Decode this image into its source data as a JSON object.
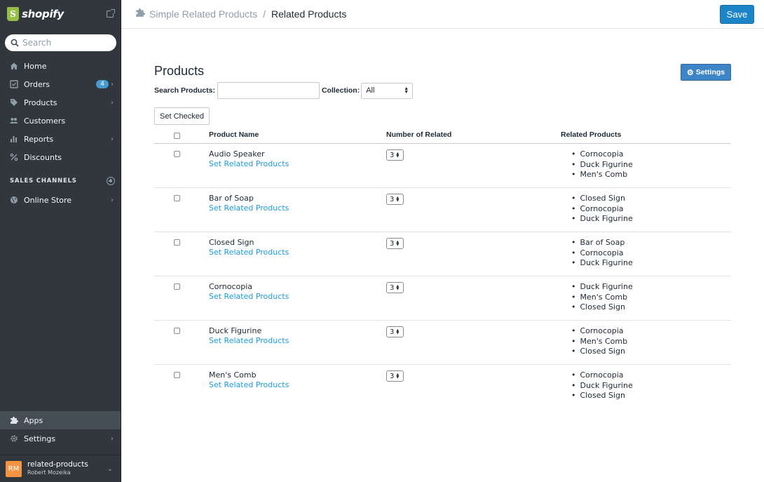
{
  "sidebar": {
    "brand": "shopify",
    "search_placeholder": "Search",
    "nav": [
      {
        "label": "Home",
        "icon": "home-icon"
      },
      {
        "label": "Orders",
        "icon": "orders-icon",
        "badge": "4"
      },
      {
        "label": "Products",
        "icon": "tag-icon"
      },
      {
        "label": "Customers",
        "icon": "customers-icon"
      },
      {
        "label": "Reports",
        "icon": "bar-chart-icon"
      },
      {
        "label": "Discounts",
        "icon": "discount-icon"
      }
    ],
    "sales_channels_heading": "SALES CHANNELS",
    "channels": [
      {
        "label": "Online Store",
        "icon": "globe-icon"
      }
    ],
    "bottom_nav": [
      {
        "label": "Apps",
        "icon": "puzzle-icon"
      },
      {
        "label": "Settings",
        "icon": "gear-icon"
      }
    ],
    "account": {
      "initials": "RM",
      "store": "related-products",
      "user": "Robert Mozeika"
    }
  },
  "topbar": {
    "app_name": "Simple Related Products",
    "separator": "/",
    "page_name": "Related Products",
    "save_label": "Save"
  },
  "main": {
    "title": "Products",
    "settings_label": "Settings",
    "search_label": "Search Products:",
    "collection_label": "Collection:",
    "collection_value": "All",
    "set_checked_label": "Set Checked",
    "columns": [
      "Product Name",
      "Number of Related",
      "Related Products"
    ],
    "link_label": "Set Related Products",
    "rows": [
      {
        "name": "Audio Speaker",
        "count": "3",
        "related": [
          "Cornocopia",
          "Duck Figurine",
          "Men's Comb"
        ]
      },
      {
        "name": "Bar of Soap",
        "count": "3",
        "related": [
          "Closed Sign",
          "Cornocopia",
          "Duck Figurine"
        ]
      },
      {
        "name": "Closed Sign",
        "count": "3",
        "related": [
          "Bar of Soap",
          "Cornocopia",
          "Duck Figurine"
        ]
      },
      {
        "name": "Cornocopia",
        "count": "3",
        "related": [
          "Duck Figurine",
          "Men's Comb",
          "Closed Sign"
        ]
      },
      {
        "name": "Duck Figurine",
        "count": "3",
        "related": [
          "Cornocopia",
          "Men's Comb",
          "Closed Sign"
        ]
      },
      {
        "name": "Men's Comb",
        "count": "3",
        "related": [
          "Cornocopia",
          "Duck Figurine",
          "Closed Sign"
        ]
      }
    ]
  },
  "colors": {
    "sidebar_bg": "#31373d",
    "accent": "#1c85c7",
    "link": "#1c9ddb",
    "badge": "#479ccf",
    "brand_green": "#95bf47"
  }
}
